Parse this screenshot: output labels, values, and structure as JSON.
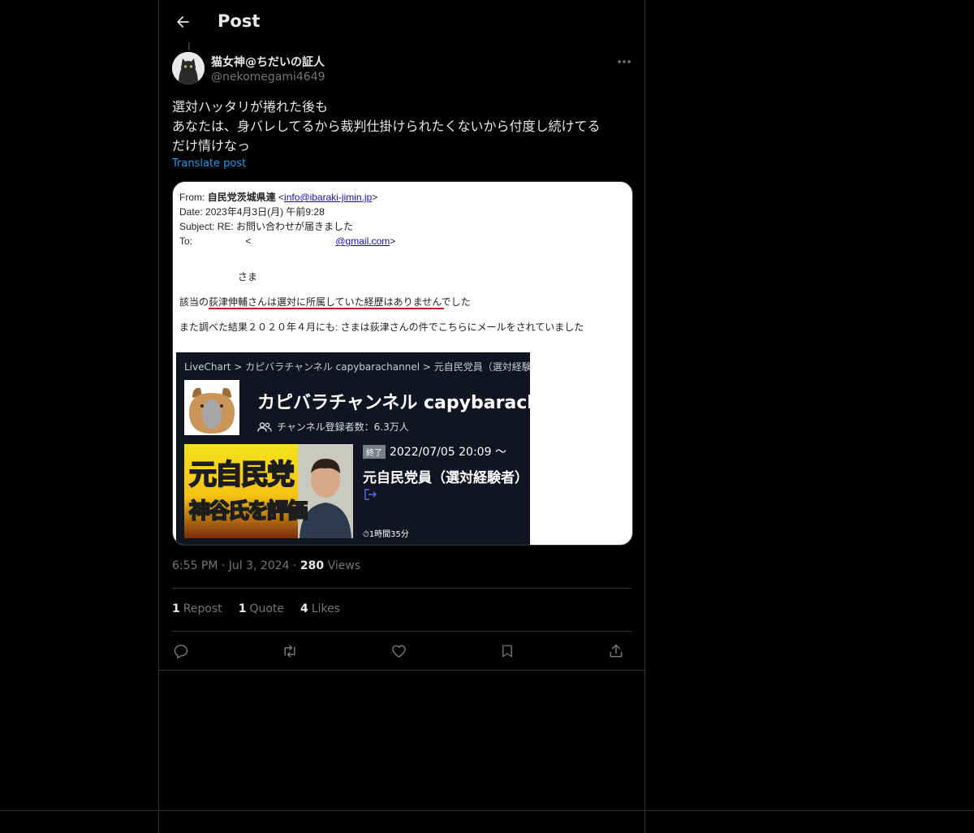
{
  "header": {
    "title": "Post"
  },
  "author": {
    "name": "猫女神@ちだいの証人",
    "handle": "@nekomegami4649"
  },
  "post": {
    "text": "選対ハッタリが捲れた後も\nあなたは、身バレしてるから裁判仕掛けられたくないから付度し続けてる\nだけ情けなっ",
    "translate_label": "Translate post"
  },
  "media": {
    "email": {
      "from_label": "From:",
      "from_name": "自民党茨城県連",
      "from_addr": "info@ibaraki-jimin.jp",
      "date_label": "Date:",
      "date_value": "2023年4月3日(月) 午前9:28",
      "subject_label": "Subject:",
      "subject_value": "RE:  お問い合わせが届きました",
      "to_label": "To:",
      "to_addr": "@gmail.com",
      "salutation": "さま",
      "line1": "該当の荻津伸輔さんは選対に所属していた経歴はありませんでした",
      "line2": "また調べた結果２０２０年４月にも:          さまは荻津さんの件でこちらにメールをされていました"
    },
    "livechart": {
      "breadcrumb": "LiveChart > カピバラチャンネル capybarachannel > 元自民党員（選対経験者）",
      "channel_title": "カピバラチャンネル capybarachan",
      "subscribers": "チャンネル登録者数：6.3万人",
      "thumb_line1": "元自民党",
      "thumb_line2": "神谷氏を評価",
      "badge": "終了",
      "date": "2022/07/05 20:09 ～",
      "video_title": "元自民党員（選対経験者）",
      "duration": "1時間35分"
    }
  },
  "meta": {
    "time": "6:55 PM",
    "sep": "·",
    "date": "Jul 3, 2024",
    "views_count": "280",
    "views_label": "Views"
  },
  "stats": {
    "reposts_count": "1",
    "reposts_label": "Repost",
    "quotes_count": "1",
    "quotes_label": "Quote",
    "likes_count": "4",
    "likes_label": "Likes"
  },
  "colors": {
    "background": "#000000",
    "text": "#e7e9ea",
    "muted": "#71767b",
    "accent": "#1d9bf0",
    "border": "#2f3336"
  },
  "icons": [
    "back-arrow-icon",
    "more-icon",
    "reply-icon",
    "repost-icon",
    "like-icon",
    "bookmark-icon",
    "share-icon"
  ]
}
